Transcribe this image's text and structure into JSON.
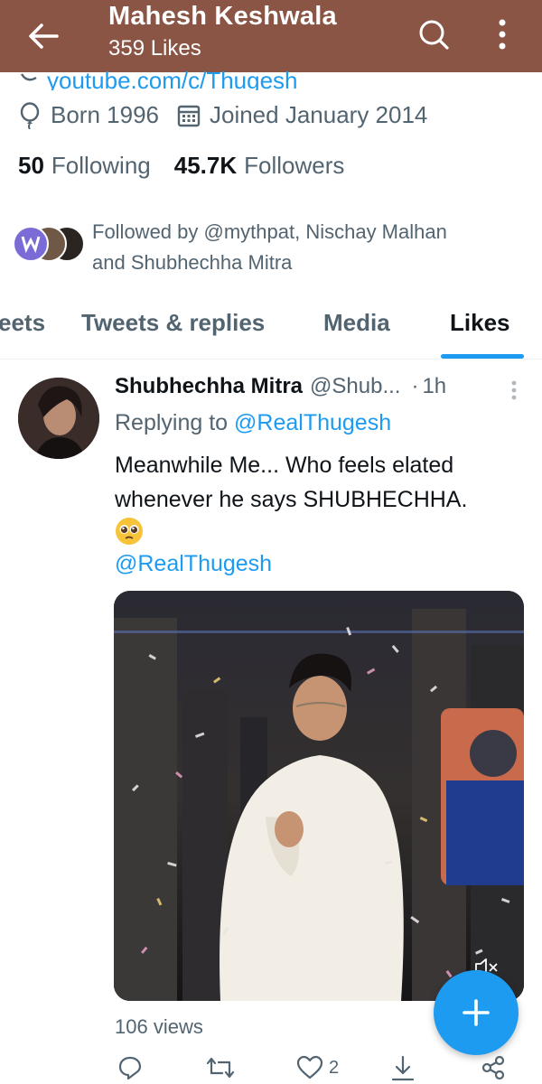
{
  "header": {
    "title": "Mahesh Keshwala",
    "subtitle": "359 Likes",
    "back_icon": "arrow-left-icon",
    "search_icon": "search-icon",
    "more_icon": "more-vertical-icon",
    "color": "#8a5544"
  },
  "profile": {
    "link": "youtube.com/c/Thugesh",
    "born": "Born 1996",
    "joined": "Joined January 2014",
    "following_count": "50",
    "following_label": "Following",
    "followers_count": "45.7K",
    "followers_label": "Followers",
    "followed_by_line1": "Followed by @mythpat, Nischay Malhan",
    "followed_by_line2": "and Shubhechha Mitra"
  },
  "tabs": [
    {
      "label": "eets",
      "active": false
    },
    {
      "label": "Tweets & replies",
      "active": false
    },
    {
      "label": "Media",
      "active": false
    },
    {
      "label": "Likes",
      "active": true
    }
  ],
  "tweet": {
    "name": "Shubhechha Mitra",
    "handle": "@Shub...",
    "dot": "·",
    "time": "1h",
    "reply_prefix": "Replying to",
    "reply_to": "@RealThugesh",
    "text": "Meanwhile Me... Who feels elated whenever he says SHUBHECHHA.",
    "mention": "@RealThugesh",
    "views": "106 views",
    "likes": "2"
  },
  "colors": {
    "accent": "#1d9bf0",
    "secondary_text": "#536471"
  }
}
